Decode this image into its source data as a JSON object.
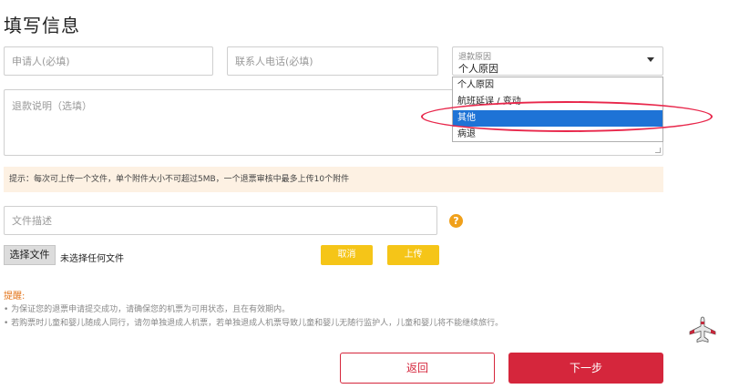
{
  "page": {
    "title": "填写信息"
  },
  "form": {
    "applicant_placeholder": "申请人(必填)",
    "phone_placeholder": "联系人电话(必填)",
    "reason_label": "退款原因",
    "reason_value": "个人原因",
    "reason_options": [
      "个人原因",
      "航班延误 / 变动",
      "其他",
      "病退"
    ],
    "reason_highlighted_option": "其他",
    "explain_placeholder": "退款说明（选填）"
  },
  "tip": {
    "text": "提示：每次可上传一个文件，单个附件大小不可超过5MB，一个退票审核中最多上传10个附件"
  },
  "upload": {
    "file_desc_placeholder": "文件描述",
    "help_symbol": "?",
    "choose_file_label": "选择文件",
    "no_file_text": "未选择任何文件",
    "cancel_label": "取消",
    "upload_label": "上传"
  },
  "reminder": {
    "title": "提醒:",
    "lines": [
      "• 为保证您的退票申请提交成功，请确保您的机票为可用状态，且在有效期内。",
      "• 若购票时儿童和婴儿随成人同行，请勿单独退成人机票，若单独退成人机票导致儿童和婴儿无随行监护人，儿童和婴儿将不能继续旅行。"
    ]
  },
  "actions": {
    "back_label": "返回",
    "next_label": "下一步"
  },
  "colors": {
    "brand_red": "#d5263c",
    "yellow_button": "#f5c518",
    "highlight_ellipse": "#e8274b",
    "selected_option": "#1e73d6",
    "tip_background": "#fdf1e3",
    "reminder_title": "#e3751a"
  },
  "icons": {
    "help": "question-circle-icon",
    "floating": "airplane-icon",
    "caret": "chevron-down-icon"
  }
}
